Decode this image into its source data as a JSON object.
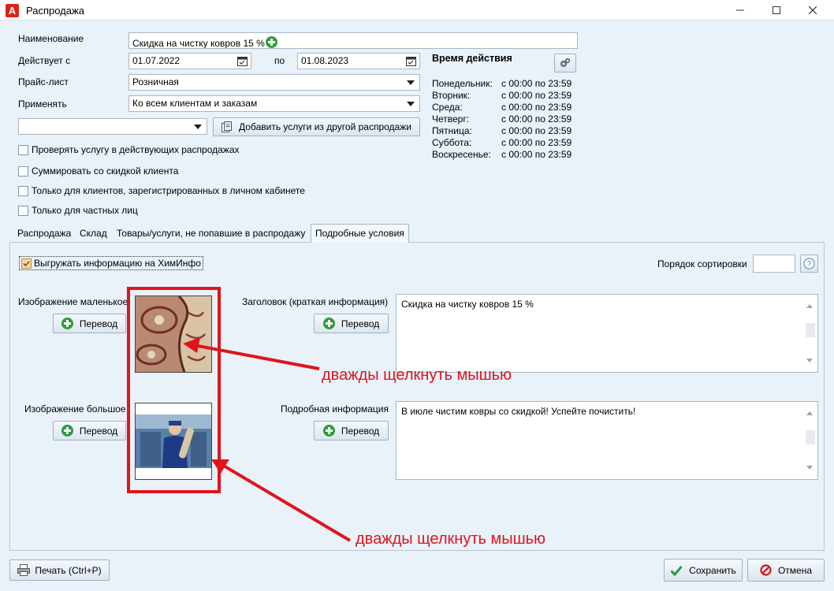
{
  "window": {
    "title": "Распродажа"
  },
  "form": {
    "name_label": "Наименование",
    "name_value": "Скидка на чистку ковров 15 %",
    "valid_from_label": "Действует с",
    "valid_from_value": "01.07.2022",
    "valid_to_label": "по",
    "valid_to_value": "01.08.2023",
    "pricelist_label": "Прайс-лист",
    "pricelist_value": "Розничная",
    "apply_label": "Применять",
    "apply_value": "Ко всем клиентам и заказам",
    "extra_combo_value": "",
    "add_services_label": "Добавить услуги из другой распродажи",
    "checkboxes": [
      {
        "label": "Проверять услугу в действующих распродажах",
        "checked": false
      },
      {
        "label": "Суммировать со скидкой клиента",
        "checked": false
      },
      {
        "label": "Только для клиентов, зарегистрированных в личном кабинете",
        "checked": false
      },
      {
        "label": "Только для частных лиц",
        "checked": false
      }
    ]
  },
  "schedule": {
    "title": "Время действия",
    "days": [
      {
        "day": "Понедельник:",
        "time": "с 00:00 по 23:59"
      },
      {
        "day": "Вторник:",
        "time": "с 00:00 по 23:59"
      },
      {
        "day": "Среда:",
        "time": "с 00:00 по 23:59"
      },
      {
        "day": "Четверг:",
        "time": "с 00:00 по 23:59"
      },
      {
        "day": "Пятница:",
        "time": "с 00:00 по 23:59"
      },
      {
        "day": "Суббота:",
        "time": "с 00:00 по 23:59"
      },
      {
        "day": "Воскресенье:",
        "time": "с 00:00 по 23:59"
      }
    ]
  },
  "tabs": [
    {
      "label": "Распродажа"
    },
    {
      "label": "Склад"
    },
    {
      "label": "Товары/услуги, не попавшие в распродажу"
    },
    {
      "label": "Подробные условия"
    }
  ],
  "details": {
    "export_label": "Выгружать информацию на ХимИнфо",
    "sort_order_label": "Порядок сортировки",
    "sort_order_value": "",
    "small_image_label": "Изображение маленькое",
    "large_image_label": "Изображение большое",
    "translate_label": "Перевод",
    "header_label": "Заголовок (краткая информация)",
    "header_value": "Скидка на чистку ковров 15 %",
    "detail_label": "Подробная информация",
    "detail_value": "В июле чистим ковры со скидкой! Успейте почистить!"
  },
  "annotations": {
    "first": "дважды щелкнуть мышью",
    "second": "дважды щелкнуть мышью",
    "color": "#e0141b"
  },
  "footer": {
    "print_label": "Печать (Ctrl+P)",
    "save_label": "Сохранить",
    "cancel_label": "Отмена"
  }
}
